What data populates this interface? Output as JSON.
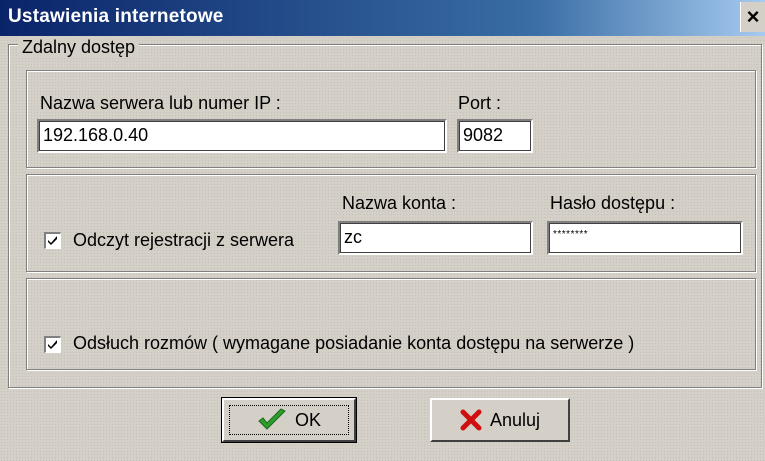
{
  "window": {
    "title": "Ustawienia internetowe",
    "close_glyph": "×"
  },
  "remote_access": {
    "legend": "Zdalny dostęp",
    "server_label": "Nazwa serwera lub numer IP :",
    "server_value": "192.168.0.40",
    "port_label": "Port :",
    "port_value": "9082"
  },
  "registration": {
    "checkbox_label": "Odczyt rejestracji z serwera",
    "checked": true,
    "account_label": "Nazwa konta :",
    "account_value": "zc",
    "password_label": "Hasło dostępu :",
    "password_value": "********"
  },
  "listening": {
    "checkbox_label": "Odsłuch rozmów ( wymagane posiadanie konta dostępu na serwerze )",
    "checked": true
  },
  "buttons": {
    "ok_label": "OK",
    "cancel_label": "Anuluj"
  },
  "colors": {
    "titlebar": "#0a246a",
    "face": "#d4d0c8",
    "ok_check": "#2e9d2e",
    "cancel_x": "#d01010"
  },
  "icons": {
    "ok": "green-check-icon",
    "cancel": "red-x-icon",
    "checkbox": "checkmark-icon"
  }
}
